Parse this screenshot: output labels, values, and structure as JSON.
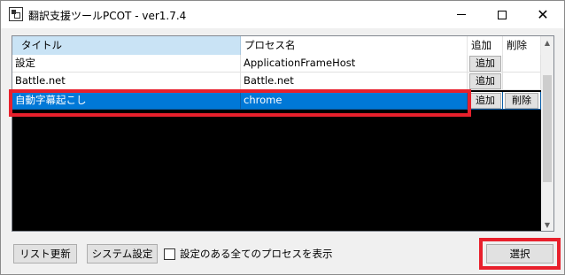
{
  "window": {
    "title": "翻訳支援ツールPCOT - ver1.7.4",
    "controls": {
      "minimize": "—",
      "maximize": "☐",
      "close": "✕"
    }
  },
  "list": {
    "columns": [
      "タイトル",
      "プロセス名",
      "追加",
      "削除"
    ],
    "rows": [
      {
        "title": "設定",
        "process": "ApplicationFrameHost",
        "add": "追加",
        "delete": "",
        "selected": false
      },
      {
        "title": "Battle.net",
        "process": "Battle.net",
        "add": "追加",
        "delete": "",
        "selected": false
      },
      {
        "title": "自動字幕起こし",
        "process": "chrome",
        "add": "追加",
        "delete": "削除",
        "selected": true
      }
    ]
  },
  "footer": {
    "refresh_label": "リスト更新",
    "settings_label": "システム設定",
    "show_all_label": "設定のある全てのプロセスを表示",
    "show_all_checked": false,
    "select_label": "選択"
  },
  "colors": {
    "selection": "#0078d7",
    "highlight": "#e8202c",
    "header_active": "#c9e3f5"
  },
  "icons": [
    "app-icon",
    "scroll-up-icon",
    "scroll-down-icon"
  ]
}
